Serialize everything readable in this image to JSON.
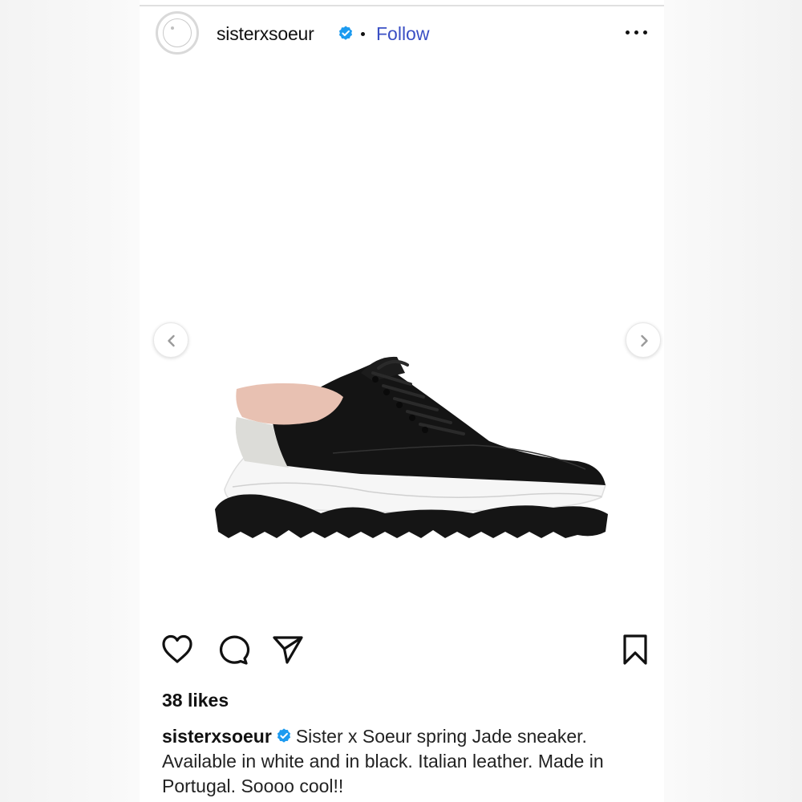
{
  "post": {
    "username": "sisterxsoeur",
    "follow_label": "Follow",
    "likes_text": "38 likes",
    "caption_user": "sisterxsoeur",
    "caption_text": "Sister x Soeur spring Jade sneaker. Available in white and in black. Italian leather. Made in Portugal. Soooo cool!!"
  },
  "icons": {
    "verified": "verified-badge-icon",
    "more": "more-options-icon",
    "like": "heart-icon",
    "comment": "comment-icon",
    "share": "send-icon",
    "save": "bookmark-icon",
    "prev": "chevron-left-icon",
    "next": "chevron-right-icon"
  },
  "colors": {
    "follow": "#3a4fc4",
    "verified": "#1d9bf0",
    "text": "#111111",
    "accent_pink": "#e8c1b2"
  }
}
